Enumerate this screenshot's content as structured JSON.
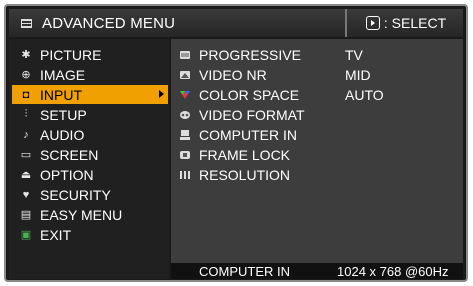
{
  "header": {
    "title": "ADVANCED MENU",
    "select_label": ": SELECT"
  },
  "sidebar": {
    "items": [
      {
        "label": "PICTURE",
        "icon": "picture-icon"
      },
      {
        "label": "IMAGE",
        "icon": "image-icon"
      },
      {
        "label": "INPUT",
        "icon": "input-icon",
        "active": true
      },
      {
        "label": "SETUP",
        "icon": "setup-icon"
      },
      {
        "label": "AUDIO",
        "icon": "audio-icon"
      },
      {
        "label": "SCREEN",
        "icon": "screen-icon"
      },
      {
        "label": "OPTION",
        "icon": "option-icon"
      },
      {
        "label": "SECURITY",
        "icon": "security-icon"
      },
      {
        "label": "EASY MENU",
        "icon": "easy-menu-icon"
      },
      {
        "label": "EXIT",
        "icon": "exit-icon"
      }
    ]
  },
  "submenu": {
    "items": [
      {
        "label": "PROGRESSIVE",
        "value": "TV",
        "icon": "progressive-icon"
      },
      {
        "label": "VIDEO NR",
        "value": "MID",
        "icon": "video-nr-icon"
      },
      {
        "label": "COLOR SPACE",
        "value": "AUTO",
        "icon": "color-space-icon"
      },
      {
        "label": "VIDEO FORMAT",
        "value": "",
        "icon": "video-format-icon"
      },
      {
        "label": "COMPUTER IN",
        "value": "",
        "icon": "computer-in-icon"
      },
      {
        "label": "FRAME LOCK",
        "value": "",
        "icon": "frame-lock-icon"
      },
      {
        "label": "RESOLUTION",
        "value": "",
        "icon": "resolution-icon"
      }
    ]
  },
  "status": {
    "source": "COMPUTER IN",
    "signal": "1024 x 768 @60Hz"
  },
  "colors": {
    "highlight": "#f0a000",
    "panel_dark": "#202020",
    "panel_mid": "#3d3d3d"
  }
}
